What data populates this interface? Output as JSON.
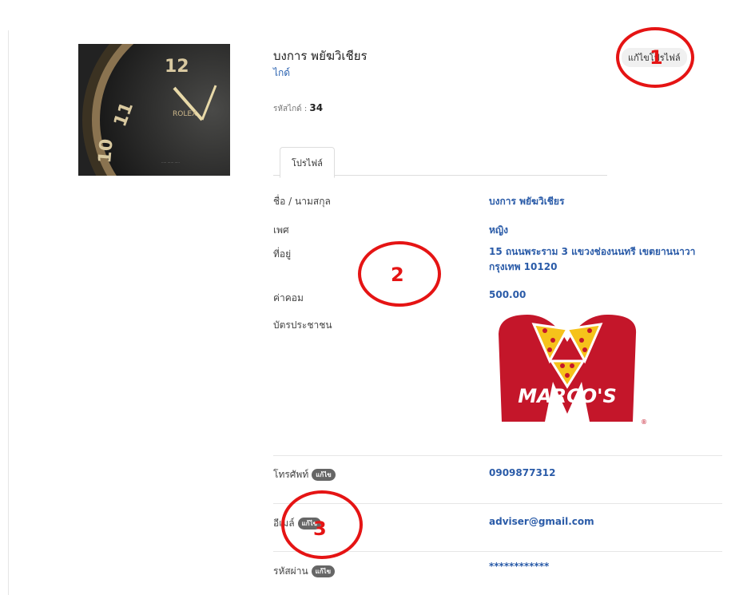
{
  "profile": {
    "name": "บงการ พยัฆวิเชียร",
    "role": "ไกด์",
    "code_label": "รหัสไกด์ :",
    "code_value": "34",
    "edit_button": "แก้ไขโปรไฟล์"
  },
  "tabs": [
    {
      "label": "โปรไฟล์",
      "active": true
    }
  ],
  "fields": {
    "fullname": {
      "label": "ชื่อ / นามสกุล",
      "value": "บงการ พยัฆวิเชียร"
    },
    "gender": {
      "label": "เพศ",
      "value": "หญิง"
    },
    "address": {
      "label": "ที่อยู่",
      "value_line1": "15 ถนนพระราม 3 แขวงช่องนนทรี เขตยานนาวา",
      "value_line2": "กรุงเทพ 10120"
    },
    "commission": {
      "label": "ค่าคอม",
      "value": "500.00"
    },
    "id_card": {
      "label": "บัตรประชาชน",
      "image_text": "MARCO'S"
    },
    "phone": {
      "label": "โทรศัพท์",
      "badge": "แก้ไข",
      "value": "0909877312"
    },
    "email": {
      "label": "อีเมล์",
      "badge": "แก้ไข",
      "value": "adviser@gmail.com"
    },
    "password": {
      "label": "รหัสผ่าน",
      "badge": "แก้ไข",
      "value": "************"
    }
  },
  "annotations": [
    "1",
    "2",
    "3"
  ],
  "colors": {
    "link_blue": "#2a5ba8",
    "marker_red": "#e51414",
    "logo_red": "#c4162a",
    "logo_yellow": "#f6c21b"
  },
  "icons": {
    "avatar": "watch-photo"
  }
}
